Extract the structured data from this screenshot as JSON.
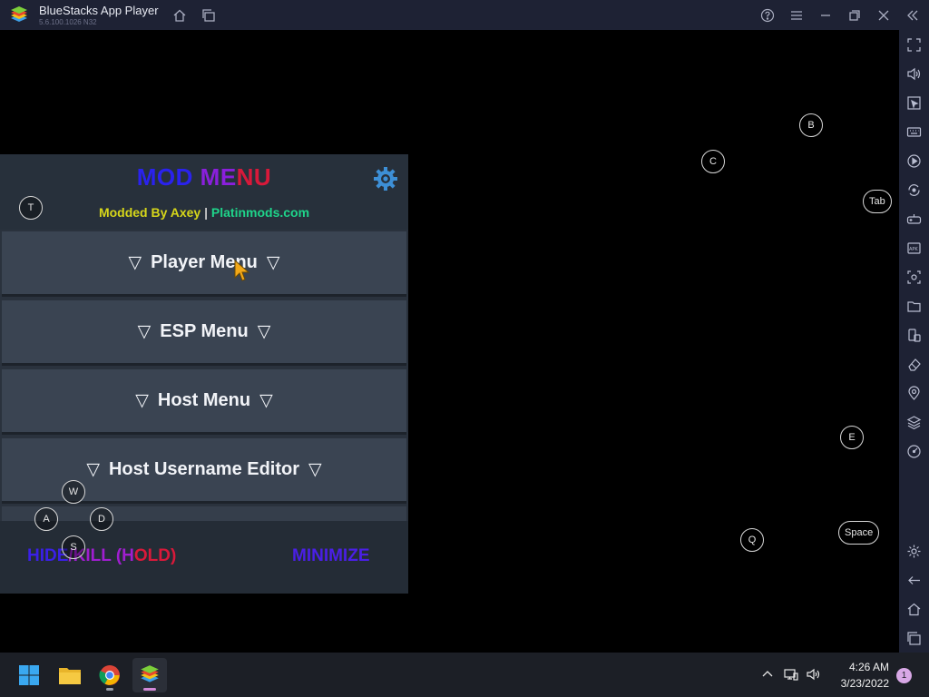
{
  "window": {
    "title": "BlueStacks App Player",
    "version": "5.6.100.1026  N32"
  },
  "titlebar_icons": [
    "home-icon",
    "multi-instance-icon",
    "help-icon",
    "hamburger-menu-icon",
    "minimize-icon",
    "restore-icon",
    "close-icon",
    "collapse-sidebar-icon"
  ],
  "mod_menu": {
    "title_part1": "MOD ",
    "title_part2": "ME",
    "title_part3": "NU",
    "subtitle_part1": "Modded By Axey",
    "subtitle_sep": " | ",
    "subtitle_part2": "Platinmods.com",
    "buttons": [
      {
        "label": "Player Menu"
      },
      {
        "label": "ESP Menu"
      },
      {
        "label": "Host Menu"
      },
      {
        "label": "Host Username Editor"
      }
    ],
    "triangle": "▽",
    "hide_part1": "HIDE",
    "hide_part2": "/KILL (H",
    "hide_part3": "OLD)",
    "minimize_label": "MINIMIZE"
  },
  "key_overlays": {
    "T": "T",
    "B": "B",
    "C": "C",
    "Tab": "Tab",
    "W": "W",
    "A": "A",
    "D": "D",
    "S": "S",
    "E": "E",
    "Q": "Q",
    "Space": "Space"
  },
  "taskbar": {
    "time": "4:26 AM",
    "date": "3/23/2022",
    "notification_count": "1"
  },
  "colors": {
    "titlebar_bg": "#1e2234",
    "panel_bg": "#2a323d",
    "button_bg": "#3a4452",
    "taskbar_bg": "#1c1f26"
  }
}
